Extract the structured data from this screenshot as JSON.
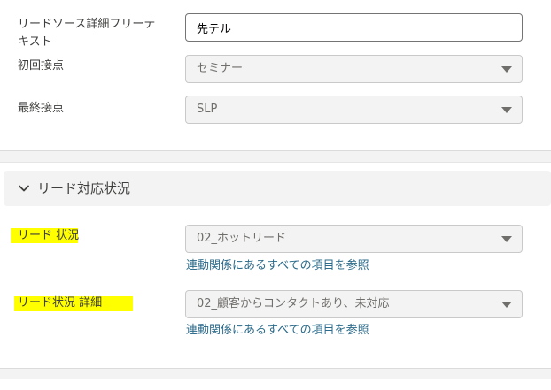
{
  "fields_top": {
    "lead_source_detail": {
      "label_line1": "リードソース詳細フリーテ",
      "label_line2": "キスト",
      "value": "先テル"
    },
    "first_contact": {
      "label": "初回接点",
      "value": "セミナー"
    },
    "last_contact": {
      "label": "最終接点",
      "value": "SLP"
    }
  },
  "section": {
    "title": "リード対応状況",
    "expanded": true
  },
  "fields_section": {
    "lead_status": {
      "label": "リード 状況",
      "value": "02_ホットリード",
      "link": "連動関係にあるすべての項目を参照"
    },
    "lead_status_detail": {
      "label": "リード状況 詳細",
      "value": "02_顧客からコンタクトあり、未対応",
      "link": "連動関係にあるすべての項目を参照"
    }
  },
  "colors": {
    "highlight": "#ffff00",
    "link": "#2a6a8a",
    "disabled_field_bg": "#f3f3f3",
    "page_bg": "#f3f3f3"
  }
}
